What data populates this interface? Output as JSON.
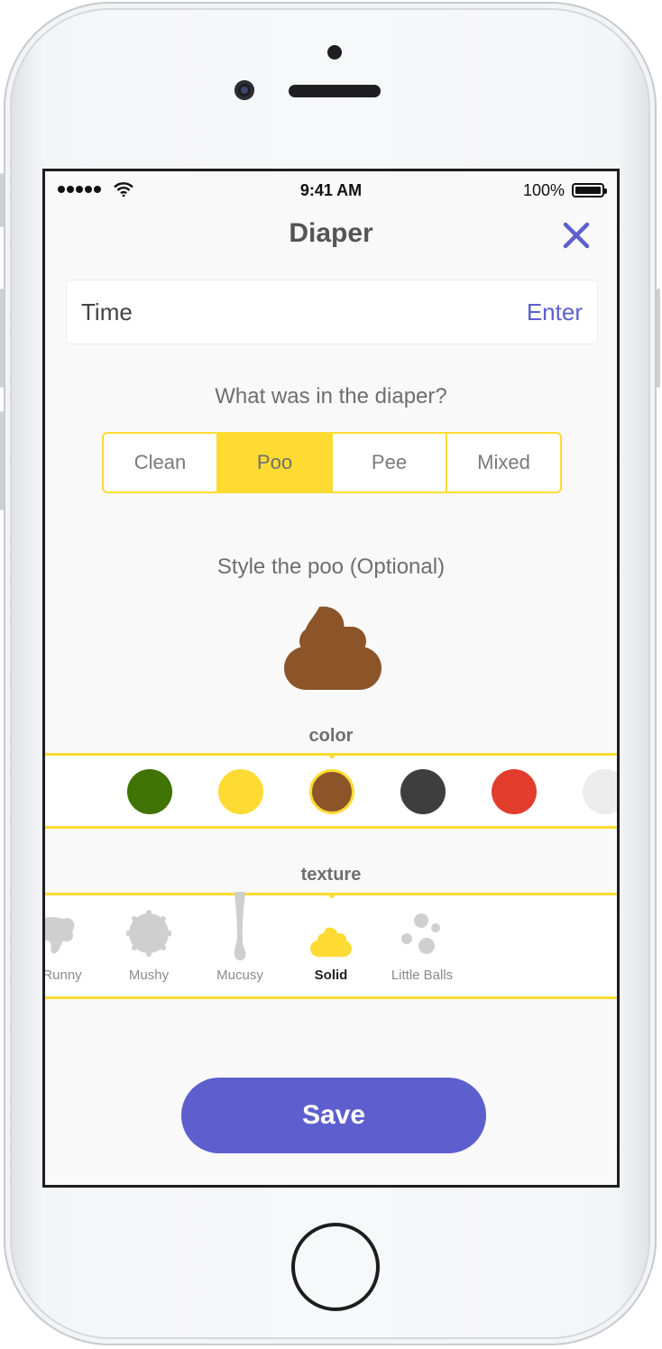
{
  "status_bar": {
    "time": "9:41 AM",
    "battery": "100%"
  },
  "header": {
    "title": "Diaper"
  },
  "time_row": {
    "label": "Time",
    "action": "Enter"
  },
  "diaper_question": "What was in the diaper?",
  "diaper_types": [
    {
      "label": "Clean",
      "selected": false
    },
    {
      "label": "Poo",
      "selected": true
    },
    {
      "label": "Pee",
      "selected": false
    },
    {
      "label": "Mixed",
      "selected": false
    }
  ],
  "style_prompt": "Style the poo (Optional)",
  "preview_color": "#8b5528",
  "color_section": {
    "label": "color",
    "swatches": [
      {
        "color": "#3f7303",
        "selected": false
      },
      {
        "color": "#fedb33",
        "selected": false
      },
      {
        "color": "#8b5528",
        "selected": true
      },
      {
        "color": "#3e3e3e",
        "selected": false
      },
      {
        "color": "#e23d2c",
        "selected": false
      },
      {
        "color": "#ececec",
        "selected": false
      }
    ]
  },
  "texture_section": {
    "label": "texture",
    "items": [
      {
        "label": "Runny",
        "icon": "runny-icon",
        "selected": false
      },
      {
        "label": "Mushy",
        "icon": "mushy-icon",
        "selected": false
      },
      {
        "label": "Mucusy",
        "icon": "mucusy-icon",
        "selected": false
      },
      {
        "label": "Solid",
        "icon": "solid-icon",
        "selected": true
      },
      {
        "label": "Little Balls",
        "icon": "little-balls-icon",
        "selected": false
      }
    ]
  },
  "save_label": "Save",
  "colors": {
    "accent": "#5d5fce",
    "highlight": "#fddb33",
    "muted_icon": "#cfcfcf"
  }
}
